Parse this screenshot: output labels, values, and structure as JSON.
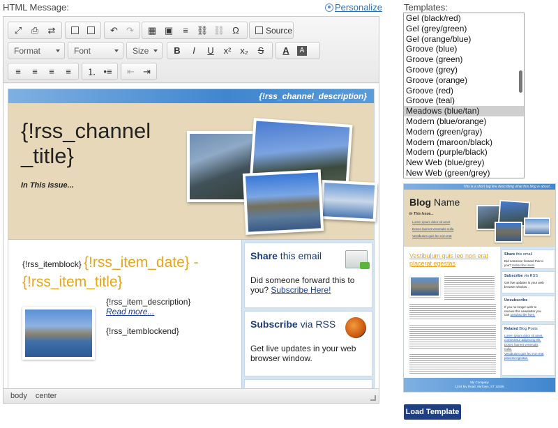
{
  "field_label": "HTML Message:",
  "personalize_label": "Personalize",
  "toolbar": {
    "source_label": "Source",
    "format_label": "Format",
    "font_label": "Font",
    "size_label": "Size",
    "bold": "B",
    "italic": "I",
    "underline": "U",
    "superscript": "x²",
    "subscript": "x₂",
    "strike": "S",
    "text_color": "A",
    "bg_color": "A",
    "omega": "Ω",
    "icons": {
      "maximize": "⤢",
      "print": "⎙",
      "find": "⇄",
      "paste_text": "📋",
      "paste_word": "📋",
      "undo": "↶",
      "redo": "↷",
      "table": "▦",
      "image": "▣",
      "hr": "≡",
      "link": "⛓",
      "unlink": "⛓",
      "align_left": "≡",
      "align_center": "≡",
      "align_right": "≡",
      "justify": "≡",
      "ordered_list": "⒈",
      "bullet_list": "•≡",
      "outdent": "⇤",
      "indent": "⇥"
    }
  },
  "content": {
    "channel_description": "{!rss_channel_description}",
    "channel_title": "{!rss_channel _title}",
    "in_this_issue": "In This Issue...",
    "item_block": "{!rss_itemblock}",
    "item_title": "{!rss_item_date} - {!rss_item_title}",
    "item_description": "{!rss_item_description}",
    "read_more": "Read more...",
    "item_block_end": "{!rss_itemblockend}",
    "share_title_bold": "Share",
    "share_title_rest": " this email",
    "share_text": "Did someone forward this to you? ",
    "share_link": "Subscribe Here!",
    "subscribe_title_bold": "Subscribe",
    "subscribe_title_rest": " via RSS",
    "subscribe_text": "Get live updates in your web browser window."
  },
  "statusbar": [
    "body",
    "center"
  ],
  "templates_label": "Templates:",
  "templates": [
    "Gel (black/red)",
    "Gel (grey/green)",
    "Gel (orange/blue)",
    "Groove (blue)",
    "Groove (green)",
    "Groove (grey)",
    "Groove (orange)",
    "Groove (red)",
    "Groove (teal)",
    "Meadows (blue/tan)",
    "Modern (blue/orange)",
    "Modern (green/gray)",
    "Modern (maroon/black)",
    "Modern (purple/black)",
    "New Web (blue/grey)",
    "New Web (green/grey)"
  ],
  "selected_template": "Meadows (blue/tan)",
  "preview": {
    "top_text": "This is a short tag line describing what this blog is about...",
    "title_bold": "Blog",
    "title_rest": " Name",
    "in_this_issue": "In This Issue...",
    "bullets": [
      "Lorem ipsum dolor sit amet",
      "Donec laoreet venenatis nulla",
      "Vestibulum quis leo non erat"
    ],
    "item_title": "Vestibulum quis leo non erat placerat egestas",
    "share_bold": "Share",
    "share_rest": " this email",
    "share_text": "Did someone forward this to you? ",
    "share_link": "Subscribe Here!",
    "subscribe_bold": "Subscribe",
    "subscribe_rest": " via RSS",
    "subscribe_text": "Get live updates in your web browser window.",
    "unsubscribe_title": "Unsubscribe",
    "unsubscribe_text": "If you no longer wish to receive this newsletter you can ",
    "unsubscribe_link": "unsubscribe here.",
    "related_bold": "Related",
    "related_rest": " Blog Posts",
    "related_links": [
      "Lorem ipsum dolor sit amet, consectetur adipiscing elit.",
      "Donec laoreet venenatis nulla.",
      "Vestibulum quis leo non erat placerat egestas."
    ],
    "footer_line1": "My Company",
    "footer_line2": "1234 My Road, MyTown, ST 12345"
  },
  "load_button": "Load Template"
}
